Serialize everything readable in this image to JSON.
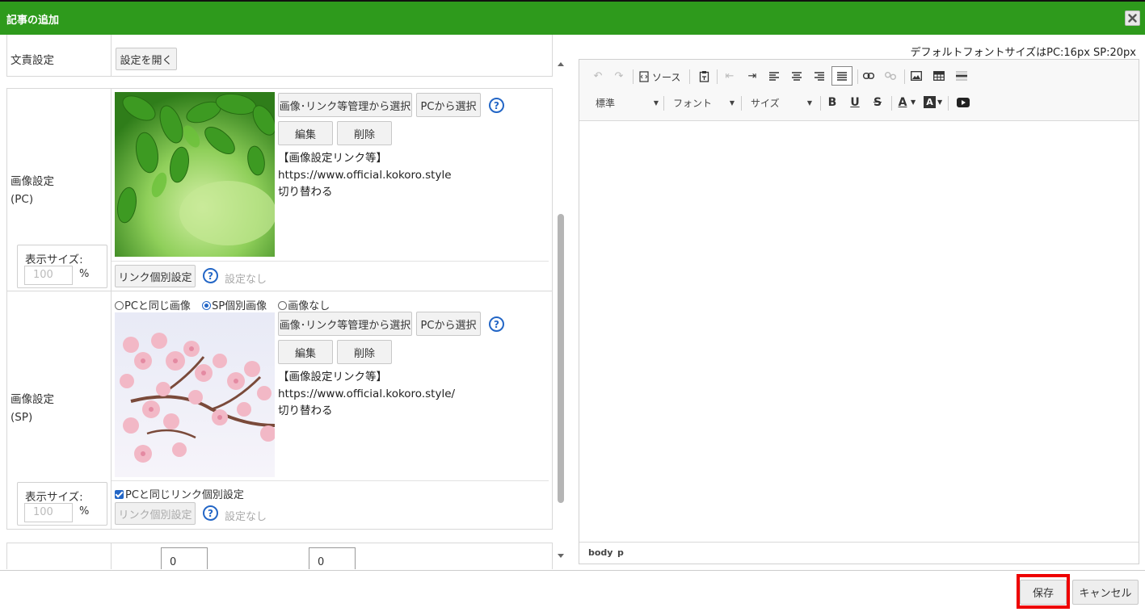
{
  "dialog": {
    "title": "記事の追加"
  },
  "font_note": "デフォルトフォントサイズはPC:16px SP:20px",
  "top_row": {
    "label": "文責設定",
    "button": "設定を開く"
  },
  "pc_image": {
    "label_line1": "画像設定",
    "label_line2": "(PC)",
    "select_manage_button": "画像･リンク等管理から選択",
    "select_pc_button": "PCから選択",
    "help": "?",
    "edit_button": "編集",
    "delete_button": "削除",
    "info_title": "【画像設定リンク等】",
    "info_url": "https://www.official.kokoro.style",
    "info_note": "切り替わる",
    "size_label": "表示サイズ:",
    "size_value": "100",
    "size_unit": "%",
    "link_button": "リンク個別設定",
    "link_status": "設定なし"
  },
  "sp_image": {
    "label_line1": "画像設定",
    "label_line2": "(SP)",
    "radio_same": "PCと同じ画像",
    "radio_individual": "SP個別画像",
    "radio_none": "画像なし",
    "select_manage_button": "画像･リンク等管理から選択",
    "select_pc_button": "PCから選択",
    "help": "?",
    "edit_button": "編集",
    "delete_button": "削除",
    "info_title": "【画像設定リンク等】",
    "info_url": "https://www.official.kokoro.style/",
    "info_note": "切り替わる",
    "size_label": "表示サイズ:",
    "size_value": "100",
    "size_unit": "%",
    "same_link_checkbox": "PCと同じリンク個別設定",
    "link_button": "リンク個別設定",
    "link_status": "設定なし"
  },
  "bottom_row": {
    "input1": "0",
    "input2": "0"
  },
  "editor": {
    "source_label": "ソース",
    "format_combo": "標準",
    "font_combo": "フォント",
    "size_combo": "サイズ",
    "bold": "B",
    "underline": "U",
    "strike": "S",
    "text_color": "A",
    "bg_color": "A",
    "status_body": "body",
    "status_p": "p"
  },
  "footer": {
    "save": "保存",
    "cancel": "キャンセル"
  },
  "colors": {
    "title_bar": "#2e9a1c",
    "highlight": "#e00000",
    "help_blue": "#2366c6"
  }
}
